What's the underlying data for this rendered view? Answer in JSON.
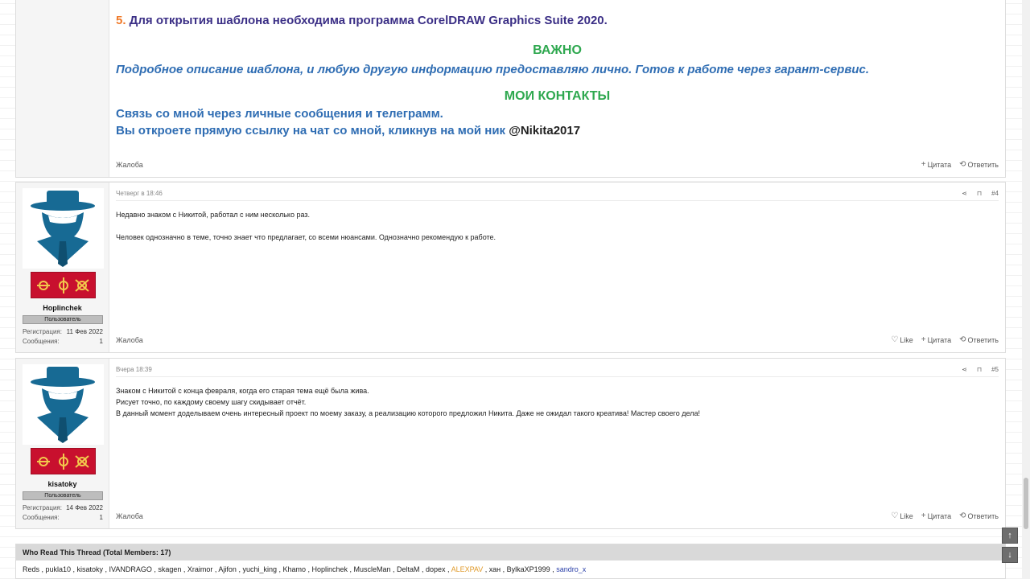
{
  "first_post": {
    "line5_num": "5.",
    "line5_text": " Для открытия шаблона необходима программа CorelDRAW Graphics Suite 2020.",
    "important_heading": "ВАЖНО",
    "important_text": "Подробное описание шаблона, и любую другую информацию предоставляю лично. Готов к работе через гарант-сервис.",
    "contacts_heading": "МОИ КОНТАКТЫ",
    "contacts_line1": "Связь со мной через личные сообщения и телеграмм.",
    "contacts_line2": "Вы откроете прямую ссылку на чат со мной, кликнув на мой ник ",
    "contacts_nick": "@Nikita2017",
    "report": "Жалоба",
    "quote": "Цитата",
    "reply": "Ответить"
  },
  "posts": [
    {
      "username": "Hoplinchek",
      "user_title": "Пользователь",
      "reg_label": "Регистрация:",
      "reg_value": "11 Фев 2022",
      "msg_label": "Сообщения:",
      "msg_value": "1",
      "date": "Четверг в 18:46",
      "number": "#4",
      "lines": [
        "Недавно знаком с Никитой, работал с ним несколько раз.",
        "",
        "Человек однозначно в теме, точно знает что предлагает, со всеми нюансами. Однозначно рекомендую к работе."
      ],
      "report": "Жалоба",
      "like": "Like",
      "quote": "Цитата",
      "reply": "Ответить"
    },
    {
      "username": "kisatoky",
      "user_title": "Пользователь",
      "reg_label": "Регистрация:",
      "reg_value": "14 Фев 2022",
      "msg_label": "Сообщения:",
      "msg_value": "1",
      "date": "Вчера 18:39",
      "number": "#5",
      "lines": [
        "Знаком с Никитой с конца февраля, когда его старая тема ещё была жива.",
        "Рисует точно, по каждому своему шагу скидывает отчёт.",
        "В данный момент доделываем очень интересный проект по моему заказу, а реализацию которого предложил Никита. Даже не ожидал такого креатива! Мастер своего дела!"
      ],
      "report": "Жалоба",
      "like": "Like",
      "quote": "Цитата",
      "reply": "Ответить"
    }
  ],
  "readers": {
    "title": "Who Read This Thread (Total Members: 17)",
    "names_plain": "Reds , pukla10 , kisatoky , IVANDRAGO , skagen , Xraimor , Ajifon , yuchi_king , Khamo , Hoplinchek , MuscleMan , DeltaM , dopex , ",
    "name_orange": "ALEXPAV",
    "names_plain2": " , хан , BylkaXP1999 , ",
    "name_blue": "sandro_x"
  },
  "colors": {
    "heading_green": "#2ea84f",
    "text_blue": "#2f6db3",
    "number_orange": "#f07a2a"
  }
}
